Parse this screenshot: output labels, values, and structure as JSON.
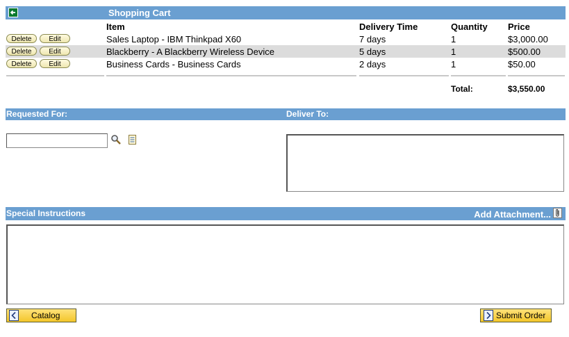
{
  "header": {
    "title": "Shopping Cart"
  },
  "columns": {
    "item": "Item",
    "delivery": "Delivery Time",
    "quantity": "Quantity",
    "price": "Price"
  },
  "rows": [
    {
      "delete": "Delete",
      "edit": "Edit",
      "item": "Sales Laptop - IBM Thinkpad X60",
      "delivery": "7 days",
      "quantity": "1",
      "price": "$3,000.00"
    },
    {
      "delete": "Delete",
      "edit": "Edit",
      "item": "Blackberry - A Blackberry Wireless Device",
      "delivery": "5 days",
      "quantity": "1",
      "price": "$500.00"
    },
    {
      "delete": "Delete",
      "edit": "Edit",
      "item": "Business Cards - Business Cards",
      "delivery": "2 days",
      "quantity": "1",
      "price": "$50.00"
    }
  ],
  "total": {
    "label": "Total:",
    "value": "$3,550.00"
  },
  "requested_for": {
    "label": "Requested For:",
    "value": ""
  },
  "deliver_to": {
    "label": "Deliver To:",
    "value": ""
  },
  "special": {
    "label": "Special Instructions",
    "attachment": "Add Attachment...",
    "value": ""
  },
  "buttons": {
    "catalog": "Catalog",
    "submit": "Submit Order"
  },
  "colors": {
    "bar": "#6a9fd1",
    "row_alt": "#dcdcdc",
    "button": "#f3c62a"
  }
}
